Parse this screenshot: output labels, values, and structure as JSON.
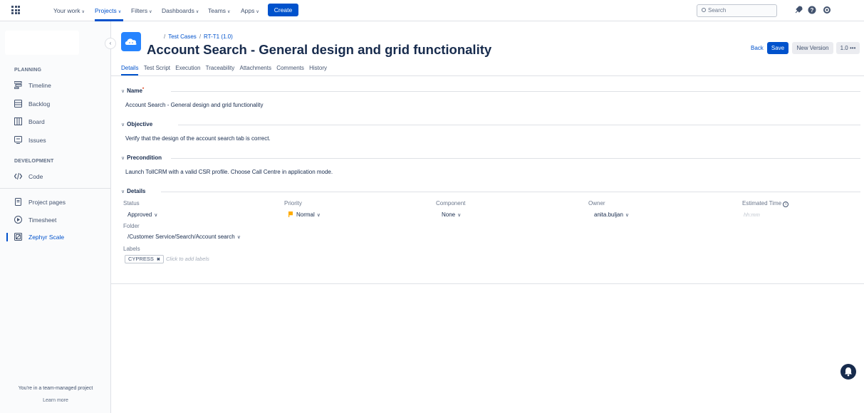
{
  "topnav": {
    "items": [
      {
        "label": "Your work"
      },
      {
        "label": "Projects"
      },
      {
        "label": "Filters"
      },
      {
        "label": "Dashboards"
      },
      {
        "label": "Teams"
      },
      {
        "label": "Apps"
      }
    ],
    "create_label": "Create",
    "search_placeholder": "Search",
    "accent": "#0052cc"
  },
  "sidebar": {
    "planning_heading": "PLANNING",
    "development_heading": "DEVELOPMENT",
    "items": [
      {
        "label": "Timeline",
        "icon": "timeline-icon"
      },
      {
        "label": "Backlog",
        "icon": "backlog-icon"
      },
      {
        "label": "Board",
        "icon": "board-icon"
      },
      {
        "label": "Issues",
        "icon": "issues-icon"
      },
      {
        "label": "Code",
        "icon": "code-icon"
      },
      {
        "label": "Project pages",
        "icon": "pages-icon"
      },
      {
        "label": "Timesheet",
        "icon": "timesheet-icon"
      },
      {
        "label": "Zephyr Scale",
        "icon": "zephyr-icon"
      }
    ],
    "team_note": "You're in a team-managed project",
    "learn_more": "Learn more"
  },
  "header": {
    "breadcrumb": [
      "Test Cases",
      "RT-T1 (1.0)"
    ],
    "title": "Account Search - General design and grid functionality",
    "back_label": "Back",
    "save_label": "Save",
    "new_version_label": "New Version",
    "version_label": "1.0 •••"
  },
  "tabs": [
    "Details",
    "Test Script",
    "Execution",
    "Traceability",
    "Attachments",
    "Comments",
    "History"
  ],
  "name_section": {
    "heading": "Name",
    "required_mark": "*",
    "value": "Account Search - General design and grid functionality"
  },
  "objective_section": {
    "heading": "Objective",
    "value": "Verify that the design of the account search tab is correct."
  },
  "precondition_section": {
    "heading": "Precondition",
    "value": "Launch TollCRM with a valid CSR profile. Choose Call Centre in application mode."
  },
  "details_section": {
    "heading": "Details",
    "status": {
      "label": "Status",
      "value": "Approved"
    },
    "priority": {
      "label": "Priority",
      "value": "Normal",
      "flag_color": "#ffab00"
    },
    "component": {
      "label": "Component",
      "value": "None"
    },
    "owner": {
      "label": "Owner",
      "value": "anita.buljan"
    },
    "estimated_time": {
      "label": "Estimated Time",
      "placeholder": "hh:mm"
    },
    "folder": {
      "label": "Folder",
      "value": "/Customer Service/Search/Account search"
    },
    "labels": {
      "label": "Labels",
      "chip": "CYPRESS",
      "add_placeholder": "Click to add labels"
    }
  }
}
